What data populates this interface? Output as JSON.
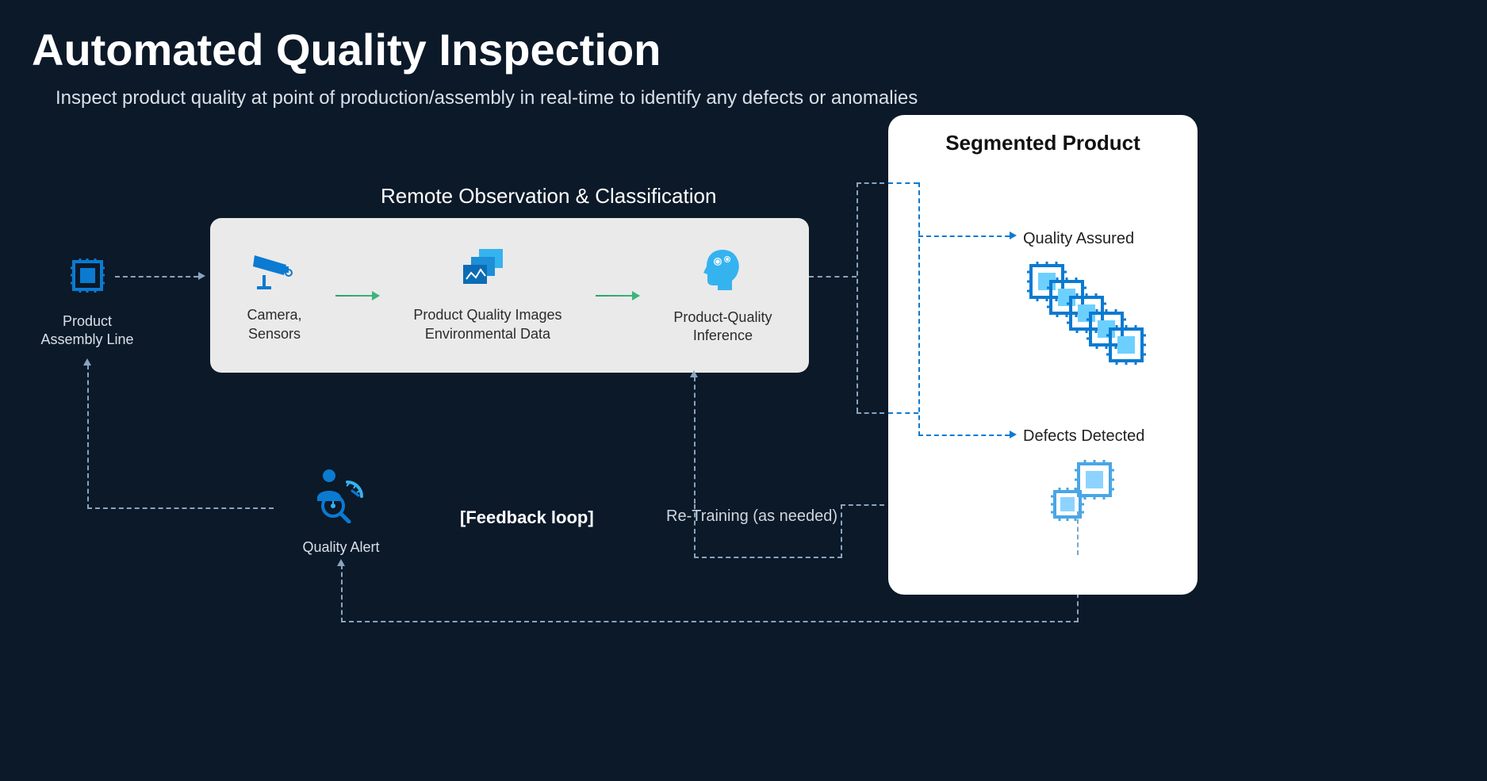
{
  "title": "Automated Quality Inspection",
  "subtitle": "Inspect product quality at point of production/assembly in real-time to identify any defects or anomalies",
  "assembly": {
    "label": "Product\nAssembly Line"
  },
  "remote": {
    "title": "Remote Observation & Classification",
    "camera": "Camera,\nSensors",
    "images": "Product Quality Images\nEnvironmental Data",
    "inference": "Product-Quality\nInference"
  },
  "quality_alert": "Quality Alert",
  "feedback_loop": "[Feedback loop]",
  "retraining": "Re-Training (as needed)",
  "segmented": {
    "title": "Segmented  Product",
    "assured": "Quality Assured",
    "defects": "Defects Detected"
  }
}
